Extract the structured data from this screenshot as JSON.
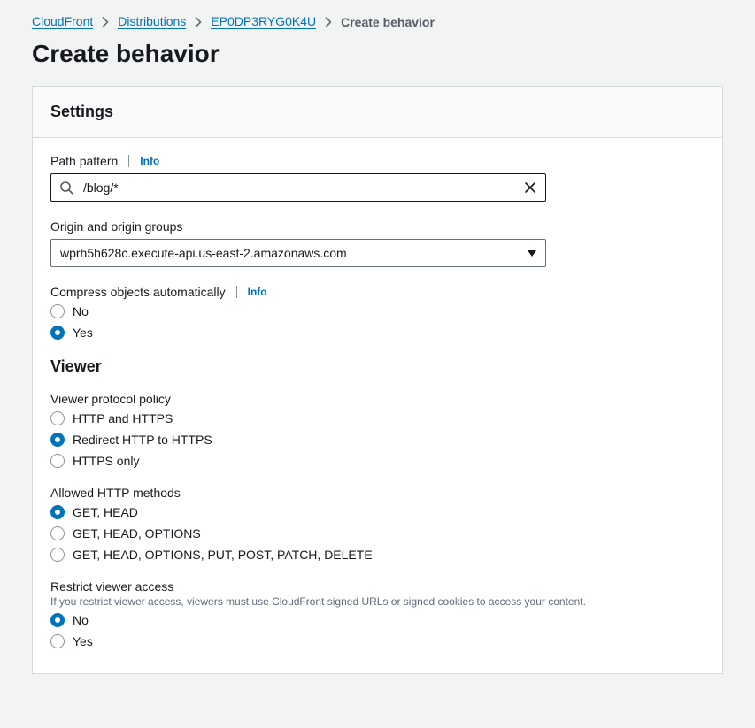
{
  "breadcrumb": {
    "items": [
      {
        "label": "CloudFront",
        "link": true
      },
      {
        "label": "Distributions",
        "link": true
      },
      {
        "label": "EP0DP3RYG0K4U",
        "link": true
      },
      {
        "label": "Create behavior",
        "link": false
      }
    ]
  },
  "page": {
    "title": "Create behavior"
  },
  "panel": {
    "heading": "Settings"
  },
  "pathPattern": {
    "label": "Path pattern",
    "info": "Info",
    "value": "/blog/*"
  },
  "origin": {
    "label": "Origin and origin groups",
    "selected": "wprh5h628c.execute-api.us-east-2.amazonaws.com"
  },
  "compress": {
    "label": "Compress objects automatically",
    "info": "Info",
    "options": [
      "No",
      "Yes"
    ],
    "selected": "Yes"
  },
  "viewer": {
    "heading": "Viewer",
    "protocolPolicy": {
      "label": "Viewer protocol policy",
      "options": [
        "HTTP and HTTPS",
        "Redirect HTTP to HTTPS",
        "HTTPS only"
      ],
      "selected": "Redirect HTTP to HTTPS"
    },
    "allowedMethods": {
      "label": "Allowed HTTP methods",
      "options": [
        "GET, HEAD",
        "GET, HEAD, OPTIONS",
        "GET, HEAD, OPTIONS, PUT, POST, PATCH, DELETE"
      ],
      "selected": "GET, HEAD"
    },
    "restrictAccess": {
      "label": "Restrict viewer access",
      "help": "If you restrict viewer access, viewers must use CloudFront signed URLs or signed cookies to access your content.",
      "options": [
        "No",
        "Yes"
      ],
      "selected": "No"
    }
  }
}
